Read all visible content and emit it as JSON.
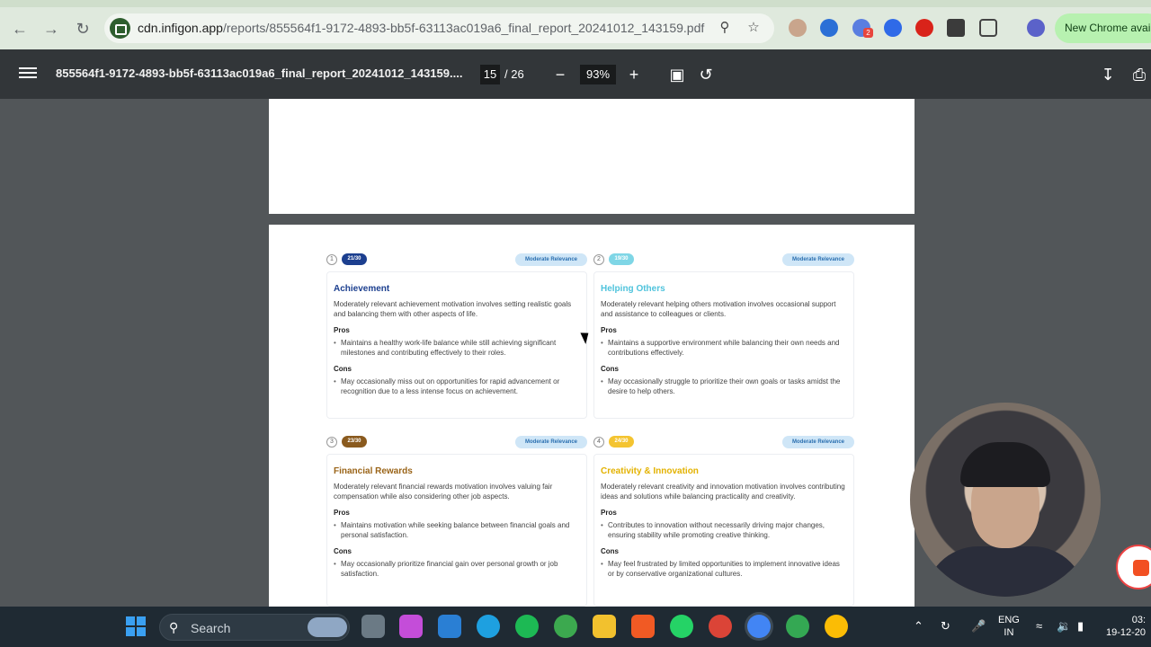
{
  "browser": {
    "url_host": "cdn.infigon.app",
    "url_path": "/reports/855564f1-9172-4893-bb5f-63113ac019a6_final_report_20241012_143159.pdf",
    "new_chrome_label": "New Chrome avail",
    "extension_badge": "2"
  },
  "pdf_toolbar": {
    "title": "855564f1-9172-4893-bb5f-63113ac019a6_final_report_20241012_143159....",
    "current_page": "15",
    "total_pages": "/ 26",
    "zoom": "93%"
  },
  "cards": [
    {
      "num": "1",
      "score": "21/30",
      "score_color": "#1c3f8f",
      "relevance": "Moderate Relevance",
      "title": "Achievement",
      "title_color": "#1c3f8f",
      "desc": "Moderately relevant achievement motivation involves setting realistic goals and balancing them with other aspects of life.",
      "pros_label": "Pros",
      "pro": "Maintains a healthy work-life balance while still achieving significant milestones and contributing effectively to their roles.",
      "cons_label": "Cons",
      "con": "May occasionally miss out on opportunities for rapid advancement or recognition due to a less intense focus on achievement."
    },
    {
      "num": "2",
      "score": "19/30",
      "score_color": "#7fd6e6",
      "relevance": "Moderate Relevance",
      "title": "Helping Others",
      "title_color": "#4fc3dc",
      "desc": "Moderately relevant helping others motivation involves occasional support and assistance to colleagues or clients.",
      "pros_label": "Pros",
      "pro": "Maintains a supportive environment while balancing their own needs and contributions effectively.",
      "cons_label": "Cons",
      "con": "May occasionally struggle to prioritize their own goals or tasks amidst the desire to help others."
    },
    {
      "num": "3",
      "score": "23/30",
      "score_color": "#8a5a1e",
      "relevance": "Moderate Relevance",
      "title": "Financial Rewards",
      "title_color": "#9a6418",
      "desc": "Moderately relevant financial rewards motivation involves valuing fair compensation while also considering other job aspects.",
      "pros_label": "Pros",
      "pro": "Maintains motivation while seeking balance between financial goals and personal satisfaction.",
      "cons_label": "Cons",
      "con": "May occasionally prioritize financial gain over personal growth or job satisfaction."
    },
    {
      "num": "4",
      "score": "24/30",
      "score_color": "#f4c430",
      "relevance": "Moderate Relevance",
      "title": "Creativity & Innovation",
      "title_color": "#e3b200",
      "desc": "Moderately relevant creativity and innovation motivation involves contributing ideas and solutions while balancing practicality and creativity.",
      "pros_label": "Pros",
      "pro": "Contributes to innovation without necessarily driving major changes, ensuring stability while promoting creative thinking.",
      "cons_label": "Cons",
      "con": "May feel frustrated by limited opportunities to implement innovative ideas or by conservative organizational cultures."
    }
  ],
  "taskbar": {
    "search_label": "Search",
    "lang_line1": "ENG",
    "lang_line2": "IN",
    "time": "03:",
    "date": "19-12-20"
  }
}
